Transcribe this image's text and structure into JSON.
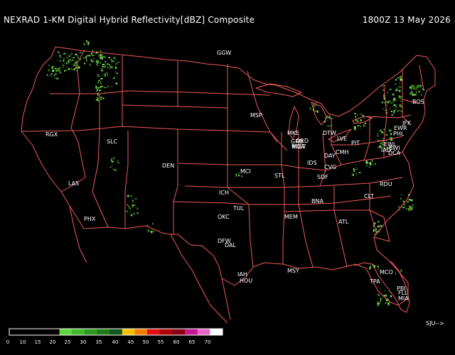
{
  "header": {
    "title": "NEXRAD 1-KM Digital Hybrid Reflectivity[dBZ] Composite",
    "timestamp": "1800Z 13 May 2026"
  },
  "navigation": {
    "next_label": "SJU-->"
  },
  "stations": [
    {
      "id": "GGW",
      "label": "GGW"
    },
    {
      "id": "MSP",
      "label": "MSP"
    },
    {
      "id": "MKE",
      "label": "MKE"
    },
    {
      "id": "DTW",
      "label": "DTW"
    },
    {
      "id": "BOS",
      "label": "BOS"
    },
    {
      "id": "GRB",
      "label": "GRB"
    },
    {
      "id": "MQT",
      "label": "MQT"
    },
    {
      "id": "LVE",
      "label": "LVE"
    },
    {
      "id": "JFK",
      "label": "JFK"
    },
    {
      "id": "EWR",
      "label": "EWR"
    },
    {
      "id": "PHL",
      "label": "PHL"
    },
    {
      "id": "RGX",
      "label": "RGX"
    },
    {
      "id": "SLC",
      "label": "SLC"
    },
    {
      "id": "ORD",
      "label": "ORD"
    },
    {
      "id": "PIT",
      "label": "PIT"
    },
    {
      "id": "NOW",
      "label": "NOW"
    },
    {
      "id": "EWL",
      "label": "EWL"
    },
    {
      "id": "BWI",
      "label": "BWI"
    },
    {
      "id": "DAY",
      "label": "DAY"
    },
    {
      "id": "CMH",
      "label": "CMH"
    },
    {
      "id": "IAD",
      "label": "IAD"
    },
    {
      "id": "DCA",
      "label": "DCA"
    },
    {
      "id": "DEN",
      "label": "DEN"
    },
    {
      "id": "IDS",
      "label": "IDS"
    },
    {
      "id": "MCI",
      "label": "MCI"
    },
    {
      "id": "CVG",
      "label": "CVG"
    },
    {
      "id": "STL",
      "label": "STL"
    },
    {
      "id": "SDF",
      "label": "SDF"
    },
    {
      "id": "LAS",
      "label": "LAS"
    },
    {
      "id": "RDU",
      "label": "RDU"
    },
    {
      "id": "ICH",
      "label": "ICH"
    },
    {
      "id": "CLT",
      "label": "CLT"
    },
    {
      "id": "BNA",
      "label": "BNA"
    },
    {
      "id": "TUL",
      "label": "TUL"
    },
    {
      "id": "PHX",
      "label": "PHX"
    },
    {
      "id": "OKC",
      "label": "OKC"
    },
    {
      "id": "MEM",
      "label": "MEM"
    },
    {
      "id": "ATL",
      "label": "ATL"
    },
    {
      "id": "DFW",
      "label": "DFW"
    },
    {
      "id": "DAL",
      "label": "DAL"
    },
    {
      "id": "MCO",
      "label": "MCO"
    },
    {
      "id": "IAH",
      "label": "IAH"
    },
    {
      "id": "HOU",
      "label": "HOU"
    },
    {
      "id": "MSY",
      "label": "MSY"
    },
    {
      "id": "TPA",
      "label": "TPA"
    },
    {
      "id": "PBI",
      "label": "PBI"
    },
    {
      "id": "FLL",
      "label": "FLL"
    },
    {
      "id": "MIA",
      "label": "MIA"
    }
  ],
  "legend": {
    "ticks": [
      "0",
      "10",
      "15",
      "20",
      "25",
      "30",
      "35",
      "40",
      "45",
      "50",
      "55",
      "60",
      "65",
      "70"
    ],
    "colors": [
      "#000000",
      "#000000",
      "#000000",
      "#000000",
      "#5fd43f",
      "#42b82a",
      "#2e9a22",
      "#1f7a18",
      "#13581a",
      "#f5c000",
      "#f07d00",
      "#e01010",
      "#b00000",
      "#8b0016",
      "#c2188e",
      "#e864c8",
      "#ffffff"
    ]
  },
  "colors": {
    "background": "#000000",
    "borders": "#f05a5a",
    "echo_light": "#4caa2c",
    "echo_medium": "#2d7a1e",
    "echo_bright": "#8be05a",
    "text": "#ffffff"
  }
}
